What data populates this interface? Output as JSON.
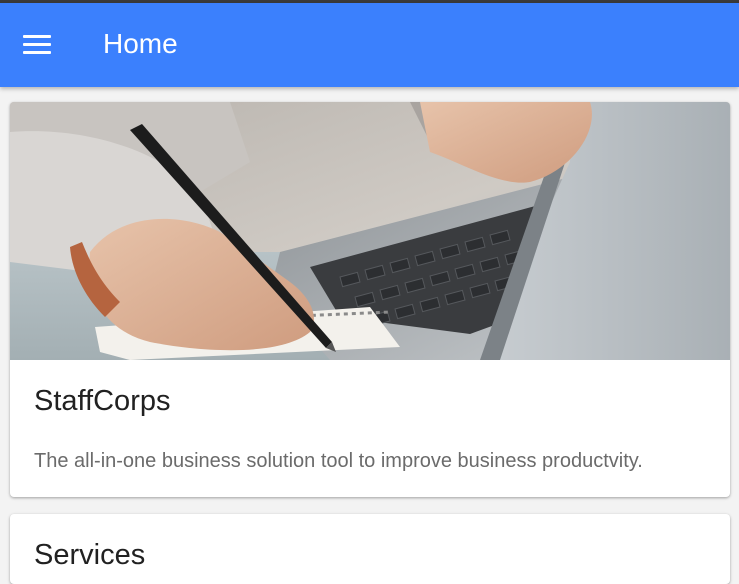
{
  "appbar": {
    "title": "Home",
    "menu_icon": "hamburger-menu-icon",
    "background": "#3b80fd"
  },
  "hero_card": {
    "image": "laptop-writing-photo",
    "title": "StaffCorps",
    "description": "The all-in-one business solution tool to improve business productvity."
  },
  "services_card": {
    "title": "Services"
  }
}
